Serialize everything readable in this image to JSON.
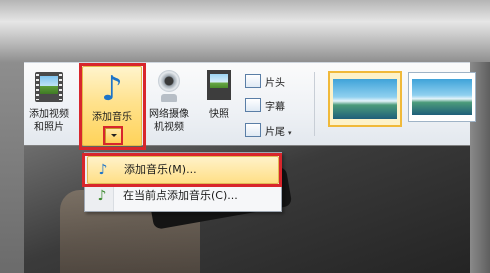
{
  "ribbon": {
    "add_video_line1": "添加视频",
    "add_video_line2": "和照片",
    "add_music": "添加音乐",
    "webcam_line1": "网络摄像",
    "webcam_line2": "机视频",
    "snapshot": "快照",
    "title_label": "片头",
    "caption_label": "字幕",
    "credits_label": "片尾",
    "credits_caret": "▾"
  },
  "menu": {
    "items": [
      {
        "label": "添加音乐(M)...",
        "icon": "music-note-icon"
      },
      {
        "label": "在当前点添加音乐(C)...",
        "icon": "music-add-icon"
      }
    ]
  },
  "icons": {
    "music_note": "♪",
    "menu_note": "♪",
    "menu_add": "♪"
  },
  "colors": {
    "highlight_border": "#d8262c",
    "hover_fill": "#ffdf86",
    "note_blue": "#1e74c8"
  }
}
